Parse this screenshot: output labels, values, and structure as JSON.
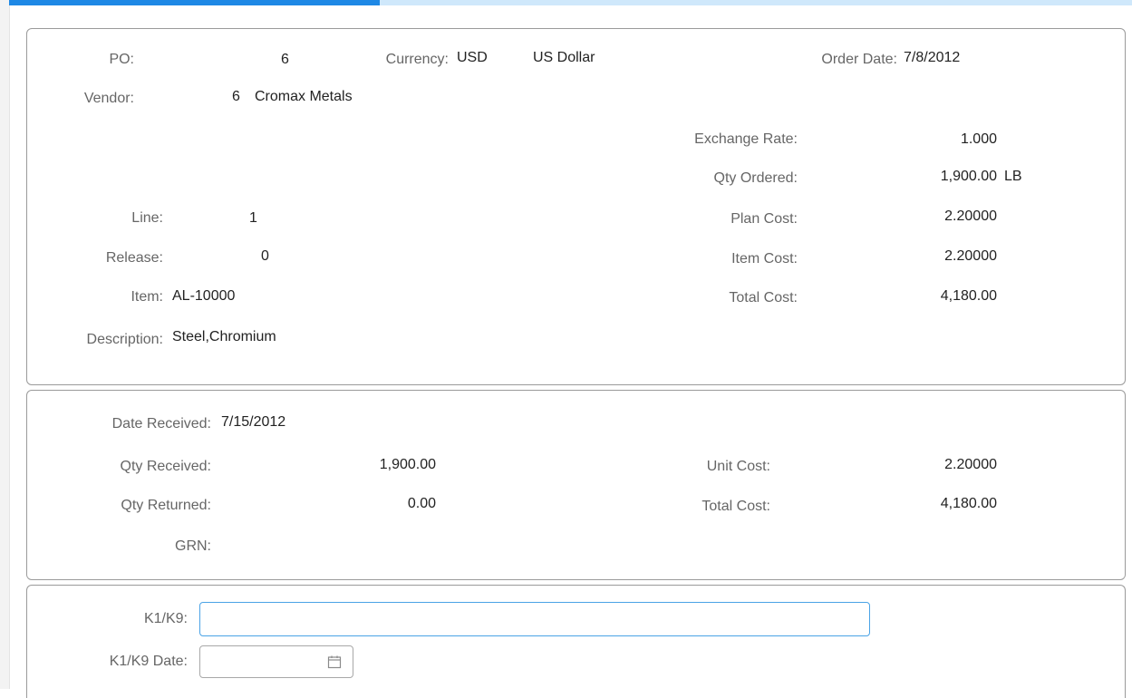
{
  "progress": {
    "percent": 33
  },
  "po_header": {
    "po_label": "PO:",
    "po_value": "6",
    "currency_label": "Currency:",
    "currency_code": "USD",
    "currency_name": "US Dollar",
    "order_date_label": "Order Date:",
    "order_date_value": "7/8/2012",
    "vendor_label": "Vendor:",
    "vendor_id": "6",
    "vendor_name": "Cromax Metals",
    "exchange_rate_label": "Exchange Rate:",
    "exchange_rate_value": "1.000",
    "qty_ordered_label": "Qty Ordered:",
    "qty_ordered_value": "1,900.00",
    "qty_ordered_uom": "LB",
    "line_label": "Line:",
    "line_value": "1",
    "plan_cost_label": "Plan Cost:",
    "plan_cost_value": "2.20000",
    "release_label": "Release:",
    "release_value": "0",
    "item_cost_label": "Item Cost:",
    "item_cost_value": "2.20000",
    "item_label": "Item:",
    "item_value": "AL-10000",
    "total_cost_label": "Total Cost:",
    "total_cost_value": "4,180.00",
    "description_label": "Description:",
    "description_value": "Steel,Chromium"
  },
  "receipt": {
    "date_received_label": "Date Received:",
    "date_received_value": "7/15/2012",
    "qty_received_label": "Qty Received:",
    "qty_received_value": "1,900.00",
    "unit_cost_label": "Unit Cost:",
    "unit_cost_value": "2.20000",
    "qty_returned_label": "Qty Returned:",
    "qty_returned_value": "0.00",
    "total_cost_label": "Total Cost:",
    "total_cost_value": "4,180.00",
    "grn_label": "GRN:",
    "grn_value": ""
  },
  "k1": {
    "k1k9_label": "K1/K9:",
    "k1k9_value": "",
    "k1k9_date_label": "K1/K9 Date:",
    "k1k9_date_value": ""
  },
  "icons": {
    "calendar": "calendar-icon"
  }
}
